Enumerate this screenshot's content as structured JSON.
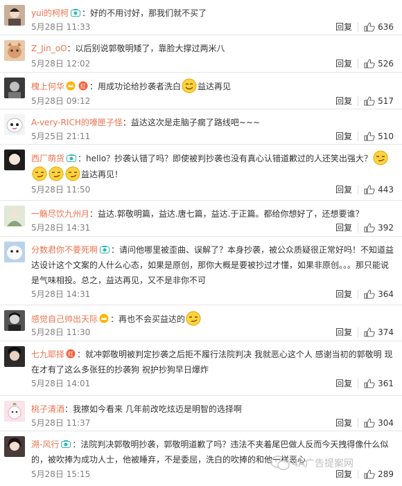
{
  "reply_label": "回复",
  "comments": [
    {
      "user": "yui的柯柯",
      "sep": "：",
      "text": "好的不用讨好，那我们就不买了",
      "date": "5月28日",
      "clock": "11:33",
      "likes": "636"
    },
    {
      "user": "Z_Jin_oO",
      "sep": "：",
      "text": "以后别说郭敬明矮了，靠脸大撑过两米八",
      "date": "5月28日",
      "clock": "12:02",
      "likes": "526"
    },
    {
      "user": "槐上何华",
      "sep": "：",
      "text_before": "用成功论给抄袭者洗白",
      "text_after": "益达再见",
      "date": "5月28日",
      "clock": "09:12",
      "likes": "517"
    },
    {
      "user": "A-very-RICH的嚎匣子怪",
      "sep": "：",
      "text": "益达这次是走脑子瘸了路线吧~~~",
      "date": "5月25日",
      "clock": "21:11",
      "likes": "510"
    },
    {
      "user": "西厂萌货",
      "sep": "：",
      "text_line1": "hello？抄袭认错了吗？即使被判抄袭也没有真心认错道歉过的人还笑出强大？",
      "text_line2": "益达再见！",
      "date": "5月28日",
      "clock": "11:50",
      "likes": "443"
    },
    {
      "user": "一觞尽饮九州月",
      "sep": "：",
      "text": "益达.郭敬明篇，益达.唐七篇，益达.于正篇。都给你想好了，还想要谁？",
      "date": "5月28日",
      "clock": "14:31",
      "likes": "392"
    },
    {
      "user": "分数君你不要死啊",
      "sep": "：",
      "text": "请问他哪里被歪曲、误解了？本身抄袭，被公众质疑很正常好吗！不知道益达设计这个文案的人什么心态，如果是原创，那你大概是要被抄过才懂，如果非原创。。。那只能说是气味相投。总之，益达再见，又不是非你不可",
      "date": "5月28日",
      "clock": "14:31",
      "likes": "364"
    },
    {
      "user": "感觉自己帅出天际",
      "sep": "：",
      "text": "再也不会买益达的",
      "date": "5月28日",
      "clock": "11:30",
      "likes": "374"
    },
    {
      "user": "七九耶择",
      "sep": "：",
      "text": "就冲郭敬明被判定抄袭之后拒不履行法院判决 我就恶心这个人 感谢当初的郭敬明 现在才有了这么多张狂的抄袭狗 祝护抄狗早日爆炸",
      "date": "5月28日",
      "clock": "14:01",
      "likes": "361"
    },
    {
      "user": "桃子清酒",
      "sep": "：",
      "text": "我擦如今看来 几年前改吃炫迈是明智的选择啊",
      "date": "5月28日",
      "clock": "11:37",
      "likes": "304"
    },
    {
      "user": "溯-风行",
      "sep": "：",
      "text": "法院判决郭敬明抄袭，郭敬明道歉了吗？违法不夹着尾巴做人反而今天拽得像什么似的，被吹捧为成功人士，他被睡弃，不是委屈，洗白的吹捧的和他一样恶心",
      "date": "5月28日",
      "clock": "15:15",
      "likes": "289"
    }
  ],
  "watermark": "4A广告提案网",
  "colors": {
    "username": "#eb7350",
    "meta": "#808080",
    "border": "#e6e6e6"
  }
}
